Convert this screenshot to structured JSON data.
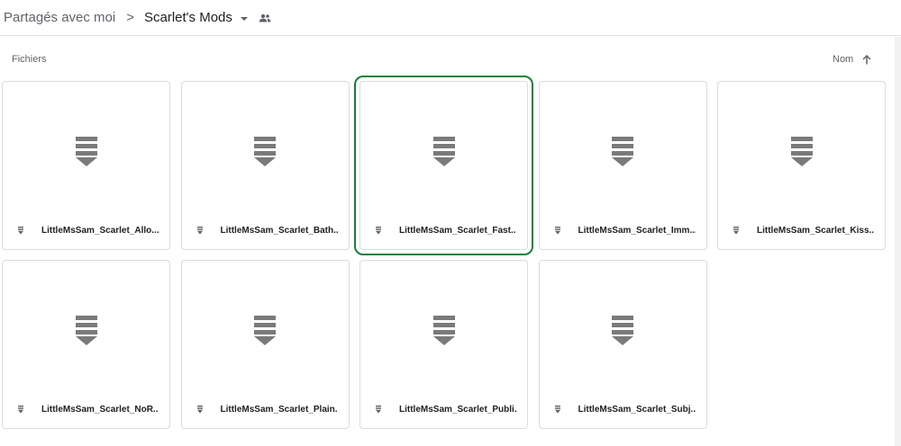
{
  "breadcrumb": {
    "root": "Partagés avec moi",
    "separator": ">",
    "current": "Scarlet's Mods",
    "shared_icon": "people-icon"
  },
  "section": {
    "label": "Fichiers"
  },
  "sort": {
    "label": "Nom",
    "direction_icon": "arrow-up-icon"
  },
  "colors": {
    "selection": "#188038",
    "icon": "#7a7a7a",
    "border": "#dadce0"
  },
  "files": [
    {
      "name": "LittleMsSam_Scarlet_Allo...",
      "selected": false
    },
    {
      "name": "LittleMsSam_Scarlet_Bath...",
      "selected": false
    },
    {
      "name": "LittleMsSam_Scarlet_Fast...",
      "selected": true
    },
    {
      "name": "LittleMsSam_Scarlet_Imm...",
      "selected": false
    },
    {
      "name": "LittleMsSam_Scarlet_Kiss...",
      "selected": false
    },
    {
      "name": "LittleMsSam_Scarlet_NoR...",
      "selected": false
    },
    {
      "name": "LittleMsSam_Scarlet_Plain...",
      "selected": false
    },
    {
      "name": "LittleMsSam_Scarlet_Publi...",
      "selected": false
    },
    {
      "name": "LittleMsSam_Scarlet_Subj...",
      "selected": false
    }
  ]
}
